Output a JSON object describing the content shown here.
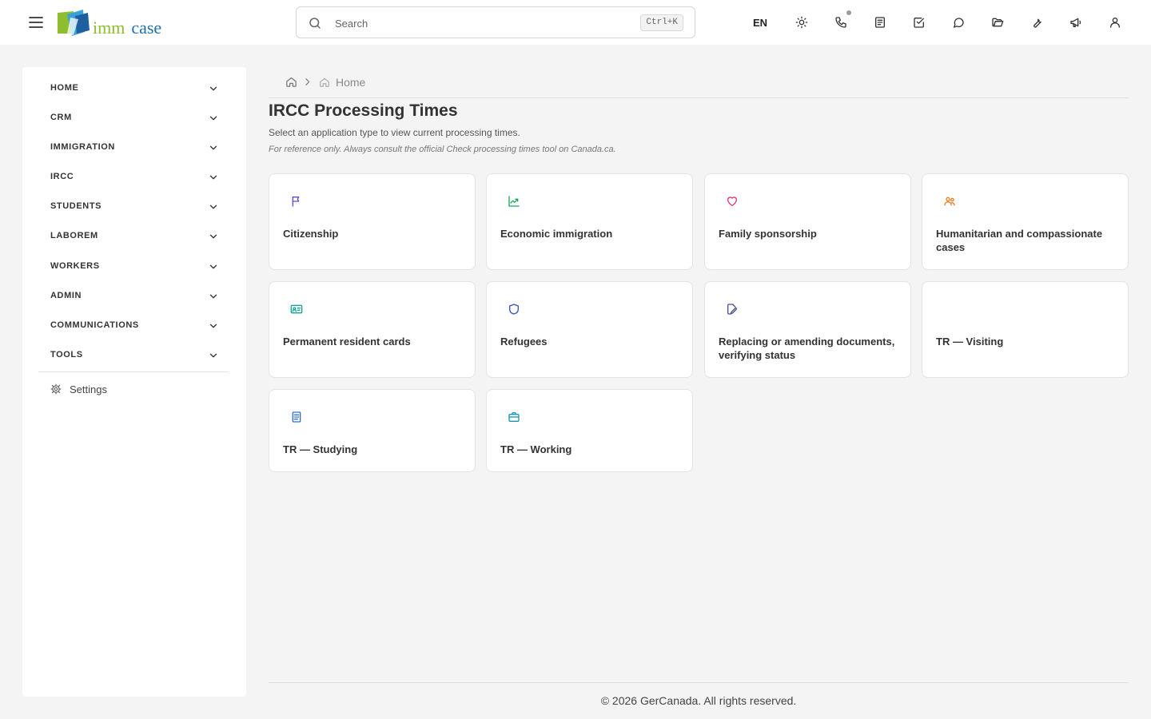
{
  "header": {
    "logo": {
      "word1": "imm",
      "word2": "case"
    },
    "search": {
      "placeholder": "Search",
      "shortcut": "Ctrl+K"
    },
    "language": "EN",
    "icons": [
      "menu-icon",
      "sun-icon",
      "phone-icon",
      "document-icon",
      "checkbox-icon",
      "chat-icon",
      "folder-icon",
      "wrench-icon",
      "megaphone-icon",
      "user-icon"
    ],
    "phone_badge_color": "#9b9b9b"
  },
  "sidebar": {
    "items": [
      {
        "label": "HOME"
      },
      {
        "label": "CRM"
      },
      {
        "label": "IMMIGRATION"
      },
      {
        "label": "IRCC"
      },
      {
        "label": "STUDENTS"
      },
      {
        "label": "LABOREM"
      },
      {
        "label": "WORKERS"
      },
      {
        "label": "ADMIN"
      },
      {
        "label": "COMMUNICATIONS"
      },
      {
        "label": "TOOLS"
      }
    ],
    "settings_label": "Settings"
  },
  "breadcrumb": {
    "current": "Home"
  },
  "main": {
    "title": "IRCC Processing Times",
    "subtitle": "Select an application type to view current processing times.",
    "note": "For reference only. Always consult the official Check processing times tool on Canada.ca.",
    "cards": [
      {
        "title": "Citizenship",
        "icon": "flag-icon",
        "color": "#5b4fc7"
      },
      {
        "title": "Economic immigration",
        "icon": "trending-up-icon",
        "color": "#1aa45a"
      },
      {
        "title": "Family sponsorship",
        "icon": "heart-icon",
        "color": "#e0357a"
      },
      {
        "title": "Humanitarian and compassionate cases",
        "icon": "people-icon",
        "color": "#e87b22"
      },
      {
        "title": "Permanent resident cards",
        "icon": "id-card-icon",
        "color": "#16a592"
      },
      {
        "title": "Refugees",
        "icon": "shield-icon",
        "color": "#3d4fc2"
      },
      {
        "title": "Replacing or amending documents, verifying status",
        "icon": "file-edit-icon",
        "color": "#4a4f8f"
      },
      {
        "title": "TR — Visiting",
        "icon": "",
        "color": ""
      },
      {
        "title": "TR — Studying",
        "icon": "book-icon",
        "color": "#2f6fd6"
      },
      {
        "title": "TR — Working",
        "icon": "briefcase-icon",
        "color": "#1596b8"
      }
    ]
  },
  "footer": {
    "copyright": "© 2026 GerCanada. All rights reserved."
  }
}
